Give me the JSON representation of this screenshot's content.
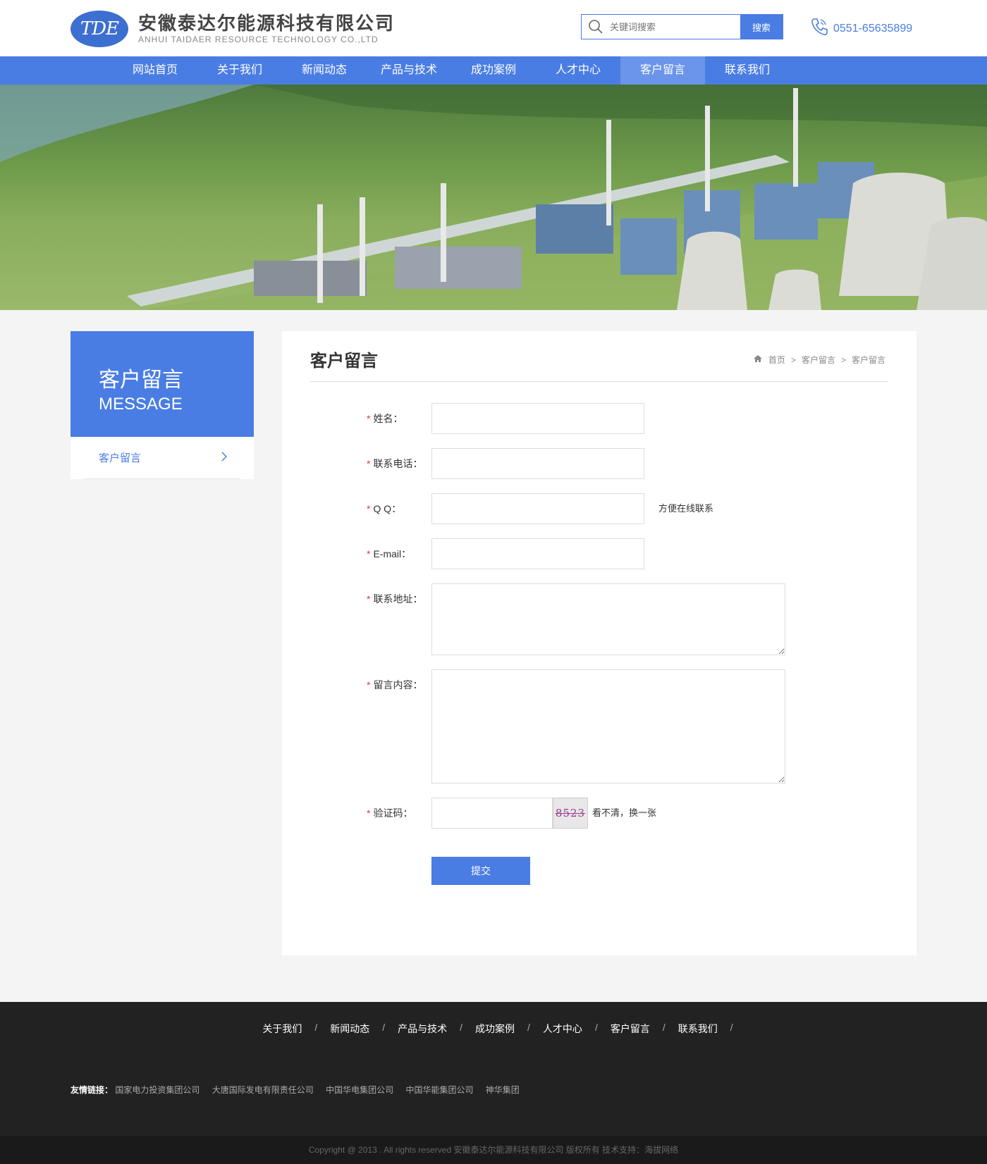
{
  "header": {
    "logo_mark": "TDE",
    "company_cn": "安徽泰达尔能源科技有限公司",
    "company_en": "ANHUI TAIDAER RESOURCE TECHNOLOGY CO.,LTD",
    "search_placeholder": "关键词搜索",
    "search_button": "搜索",
    "phone": "0551-65635899"
  },
  "nav": {
    "items": [
      "网站首页",
      "关于我们",
      "新闻动态",
      "产品与技术",
      "成功案例",
      "人才中心",
      "客户留言",
      "联系我们"
    ],
    "active_index": 6
  },
  "sidebar": {
    "title": "客户留言",
    "subtitle": "MESSAGE",
    "item": "客户留言"
  },
  "content": {
    "title": "客户留言",
    "breadcrumb": [
      "首页",
      "客户留言",
      "客户留言"
    ],
    "breadcrumb_sep": ">"
  },
  "form": {
    "star": "*",
    "name_label": "姓名：",
    "phone_label": "联系电话：",
    "qq_label": "Q Q：",
    "qq_hint": "方便在线联系",
    "email_label": "E-mail：",
    "address_label": "联系地址：",
    "message_label": "留言内容：",
    "captcha_label": "验证码：",
    "captcha_text": "8523",
    "captcha_refresh": "看不清，换一张",
    "submit": "提交"
  },
  "footer": {
    "nav": [
      "关于我们",
      "新闻动态",
      "产品与技术",
      "成功案例",
      "人才中心",
      "客户留言",
      "联系我们"
    ],
    "sep": "/",
    "friends_label": "友情链接：",
    "friends": [
      "国家电力投资集团公司",
      "大唐国际发电有限责任公司",
      "中国华电集团公司",
      "中国华能集团公司",
      "神华集团"
    ],
    "copyright": "Copyright @ 2013 . All rights reserved 安徽泰达尔能源科技有限公司 版权所有 技术支持：海拔网络"
  },
  "colors": {
    "primary": "#4a7de3",
    "footer_bg": "#222222"
  }
}
